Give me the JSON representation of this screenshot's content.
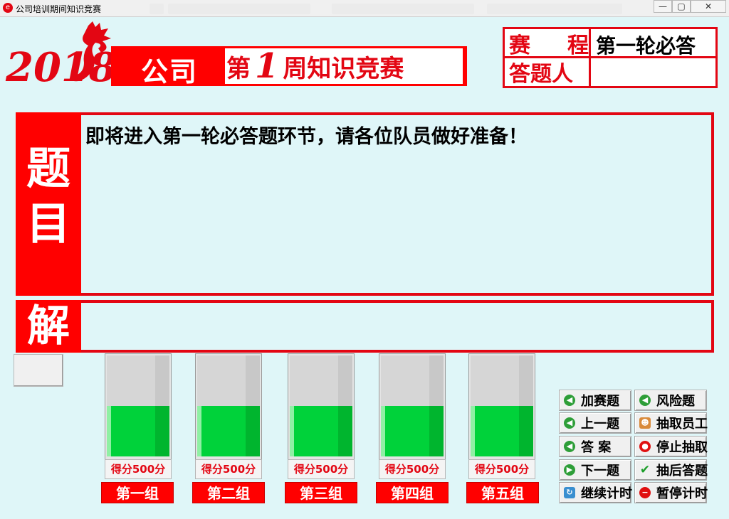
{
  "window": {
    "title": "公司培训期间知识竞赛",
    "controls": [
      "—",
      "▢",
      "✕"
    ]
  },
  "header": {
    "logo_text": "2018",
    "company": "公司",
    "week_prefix": "第",
    "week_number": "1",
    "week_suffix": "周知识竞赛"
  },
  "info": {
    "stage_label": [
      "赛",
      "程"
    ],
    "stage_value": "第一轮必答",
    "answerer_label": "答题人",
    "answerer_value": ""
  },
  "question": {
    "side_label": [
      "题",
      "目"
    ],
    "text": "即将进入第一轮必答题环节，请各位队员做好准备！"
  },
  "answer": {
    "side_label": "解",
    "text": ""
  },
  "teams": [
    {
      "name": "第一组",
      "score_label": "得分500分",
      "fill_fraction": 0.5
    },
    {
      "name": "第二组",
      "score_label": "得分500分",
      "fill_fraction": 0.5
    },
    {
      "name": "第三组",
      "score_label": "得分500分",
      "fill_fraction": 0.5
    },
    {
      "name": "第四组",
      "score_label": "得分500分",
      "fill_fraction": 0.5
    },
    {
      "name": "第五组",
      "score_label": "得分500分",
      "fill_fraction": 0.5
    }
  ],
  "controls": {
    "extra_question": {
      "label": "加赛题",
      "icon": "green-left-arrow-icon"
    },
    "risk_question": {
      "label": "风险题",
      "icon": "green-left-arrow-icon"
    },
    "prev_question": {
      "label": "上一题",
      "icon": "green-left-arrow-icon"
    },
    "draw_employee": {
      "label": "抽取员工",
      "icon": "person-icon"
    },
    "answer": {
      "label": "答 案",
      "icon": "green-left-arrow-icon"
    },
    "stop_draw": {
      "label": "停止抽取",
      "icon": "red-stop-icon"
    },
    "next_question": {
      "label": "下一题",
      "icon": "green-right-arrow-icon"
    },
    "answer_after_draw": {
      "label": "抽后答题",
      "icon": "check-icon"
    },
    "resume_timer": {
      "label": "继续计时",
      "icon": "refresh-icon"
    },
    "pause_timer": {
      "label": "暂停计时",
      "icon": "red-minus-icon"
    }
  }
}
